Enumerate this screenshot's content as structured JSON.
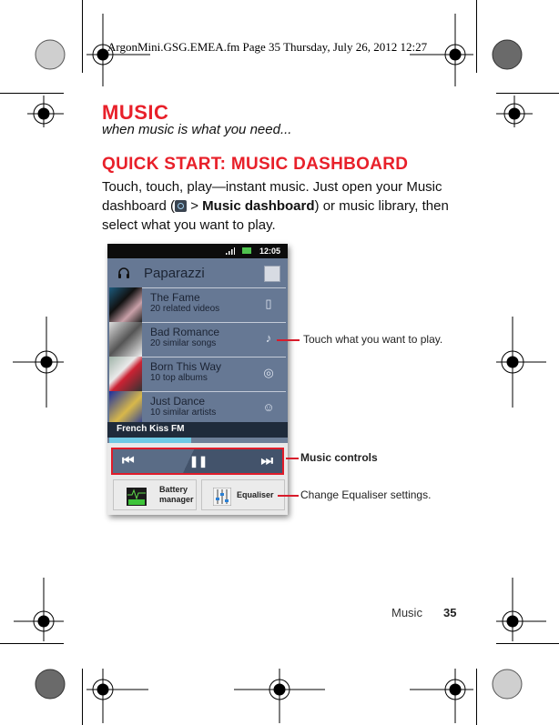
{
  "print_header": "ArgonMini.GSG.EMEA.fm  Page 35  Thursday, July 26, 2012  12:27",
  "page": {
    "title": "MUSIC",
    "subtitle": "when music is what you need...",
    "section_heading": "QUICK START: MUSIC DASHBOARD",
    "body": {
      "part1": "Touch, touch, play—instant music. Just open your Music dashboard (",
      "icon": "music-dashboard-app-icon",
      "part2": " > ",
      "bold": "Music dashboard",
      "part3": ") or music library, then select what you want to play."
    }
  },
  "phone": {
    "status_bar": {
      "time": "12:05",
      "icons": [
        "signal-icon",
        "battery-icon"
      ]
    },
    "app_bar": {
      "title": "Paparazzi",
      "icon": "headphones-icon",
      "action_icon": "edit-icon"
    },
    "items": [
      {
        "title": "The Fame",
        "subtitle": "20 related videos",
        "icon": "film-icon",
        "glyph": "▯"
      },
      {
        "title": "Bad Romance",
        "subtitle": "20 similar songs",
        "icon": "music-note-icon",
        "glyph": "♪"
      },
      {
        "title": "Born This Way",
        "subtitle": "10 top albums",
        "icon": "album-disc-icon",
        "glyph": "◎"
      },
      {
        "title": "Just Dance",
        "subtitle": "10 similar artists",
        "icon": "artist-icon",
        "glyph": "☺"
      }
    ],
    "station": "French Kiss FM",
    "progress": 0.46,
    "controls": {
      "previous": "⏮",
      "pause": "❚❚",
      "next": "⏭"
    },
    "widgets": [
      {
        "label_line1": "Battery",
        "label_line2": "manager",
        "icon": "battery-manager-icon"
      },
      {
        "label": "Equaliser",
        "icon": "equaliser-icon"
      }
    ]
  },
  "callouts": {
    "touch": "Touch what you want to play.",
    "controls": "Music controls",
    "equaliser": "Change Equaliser settings."
  },
  "footer": {
    "section": "Music",
    "page_number": "35"
  },
  "colors": {
    "accent_red": "#e8202a",
    "screen_blue": "#667894",
    "station_bar": "#1f2b3b",
    "progress_fill": "#6fc9e4"
  }
}
